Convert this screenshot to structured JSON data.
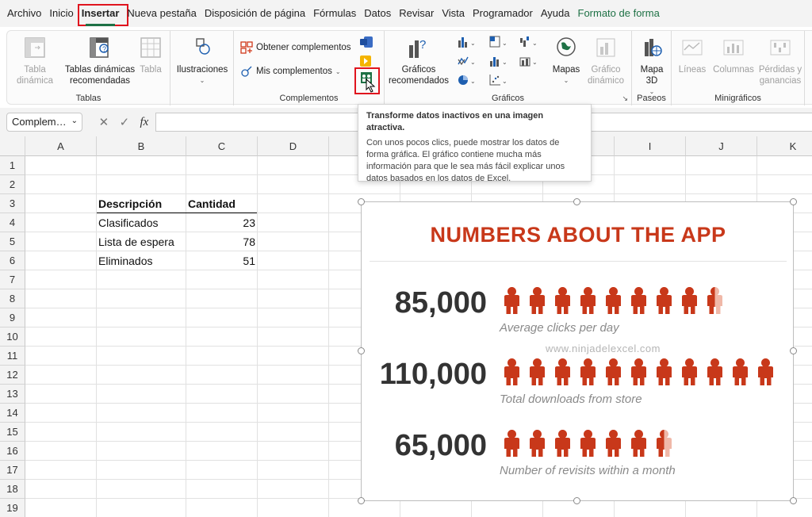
{
  "menu": {
    "tabs": [
      "Archivo",
      "Inicio",
      "Insertar",
      "Nueva pestaña",
      "Disposición de página",
      "Fórmulas",
      "Datos",
      "Revisar",
      "Vista",
      "Programador",
      "Ayuda",
      "Formato de forma"
    ],
    "active_tab": "Insertar"
  },
  "ribbon": {
    "tablas": {
      "label": "Tablas",
      "tabla_dinamica": "Tabla dinámica",
      "tablas_dinamicas_recomendadas": "Tablas dinámicas recomendadas",
      "tabla": "Tabla"
    },
    "ilustraciones": {
      "label": "Ilustraciones"
    },
    "complementos": {
      "label": "Complementos",
      "obtener": "Obtener complementos",
      "mis": "Mis complementos"
    },
    "graficos": {
      "label": "Gráficos",
      "recomendados": "Gráficos recomendados",
      "mapas": "Mapas",
      "grafico_dinamico": "Gráfico dinámico"
    },
    "paseos": {
      "label": "Paseos",
      "mapa3d": "Mapa 3D"
    },
    "minigraficos": {
      "label": "Minigráficos",
      "lineas": "Líneas",
      "columnas": "Columnas",
      "perdidas": "Pérdidas y ganancias"
    }
  },
  "formula_bar": {
    "name_box": "Complem…",
    "fx": "fx"
  },
  "tooltip": {
    "title": "Transforme datos inactivos en una imagen atractiva.",
    "body": "Con unos pocos clics, puede mostrar los datos de forma gráfica. El gráfico contiene mucha más información para que le sea más fácil explicar unos datos basados en los datos de Excel."
  },
  "grid": {
    "columns": [
      "A",
      "B",
      "C",
      "D",
      "E",
      "F",
      "G",
      "H",
      "I",
      "J",
      "K"
    ],
    "rows": [
      "1",
      "2",
      "3",
      "4",
      "5",
      "6",
      "7",
      "8",
      "9",
      "10",
      "11",
      "12",
      "13",
      "14",
      "15",
      "16",
      "17",
      "18",
      "19"
    ],
    "table": {
      "headers": [
        "Descripción",
        "Cantidad"
      ],
      "rows": [
        [
          "Clasificados",
          "23"
        ],
        [
          "Lista de espera",
          "78"
        ],
        [
          "Eliminados",
          "51"
        ]
      ]
    }
  },
  "infographic": {
    "title": "NUMBERS ABOUT THE APP",
    "watermark": "www.ninjadelexcel.com",
    "accent_color": "#c8381a",
    "faded_color": "#f0b8a8",
    "stats": [
      {
        "value": "85,000",
        "label": "Average clicks per day",
        "icons": 9,
        "fill": 8.5
      },
      {
        "value": "110,000",
        "label": "Total downloads from store",
        "icons": 11,
        "fill": 11
      },
      {
        "value": "65,000",
        "label": "Number of revisits within a month",
        "icons": 7,
        "fill": 6.5
      }
    ]
  }
}
